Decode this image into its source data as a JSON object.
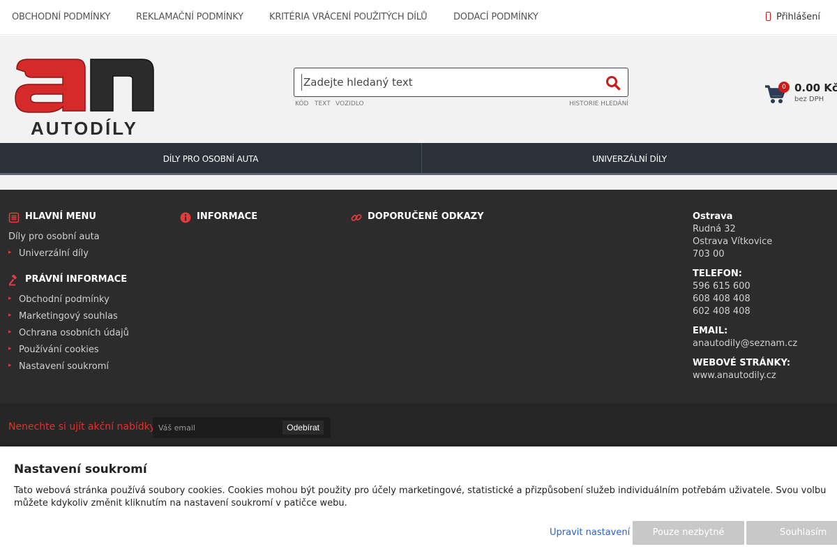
{
  "topbar": {
    "links": [
      "OBCHODNÍ PODMÍNKY",
      "REKLAMAČNÍ PODMÍNKY",
      "KRITÉRIA VRÁCENÍ POUŽITÝCH DÍLŮ",
      "DODACÍ PODMÍNKY"
    ],
    "login_label": "Přihlášení"
  },
  "logo": {
    "text": "AUTODÍLY",
    "colors": {
      "red": "#d42a2a",
      "dark": "#2b2b2b"
    }
  },
  "search": {
    "placeholder": "Zadejte hledaný text",
    "modes": [
      "KÓD",
      "TEXT",
      "VOZIDLO"
    ],
    "history_label": "HISTORIE HLEDÁNÍ"
  },
  "cart": {
    "count": "0",
    "price": "0.00 Kč",
    "vat_note": "bez DPH"
  },
  "nav": {
    "items": [
      "DÍLY PRO OSOBNÍ AUTA",
      "UNIVERZÁLNÍ DÍLY"
    ]
  },
  "footer": {
    "main_menu": {
      "title": "HLAVNÍ MENU",
      "items": [
        "Díly pro osobní auta",
        "Univerzální díly"
      ]
    },
    "legal": {
      "title": "PRÁVNÍ INFORMACE",
      "items": [
        "Obchodní podmínky",
        "Marketingový souhlas",
        "Ochrana osobních údajů",
        "Používání cookies",
        "Nastavení soukromí"
      ]
    },
    "info": {
      "title": "INFORMACE"
    },
    "links": {
      "title": "DOPORUČENÉ ODKAZY"
    },
    "contact": {
      "city": "Ostrava",
      "street": "Rudná 32",
      "district": "Ostrava Vítkovice",
      "zip": "703 00",
      "phone_label": "TELEFON:",
      "phones": [
        "596 615 600",
        "608 408 408",
        "602 408 408"
      ],
      "email_label": "EMAIL:",
      "email": "anautodily@seznam.cz",
      "web_label": "WEBOVÉ STRÁNKY:",
      "web": "www.anautodily.cz"
    }
  },
  "newsletter": {
    "label": "Nenechte si ujít akční nabídky",
    "placeholder": "Váš email",
    "button": "Odebírat"
  },
  "cookie": {
    "title": "Nastavení soukromí",
    "text": "Tato webová stránka používá soubory cookies. Cookies mohou být použity pro účely marketingové, statistické a přizpůsobení služeb individuálním potřebám uživatele. Svou volbu můžete kdykoliv změnit kliknutím na nastavení soukromí v patičce webu.",
    "settings_link": "Upravit nastavení",
    "necessary_button": "Pouze nezbytné",
    "accept_button": "Souhlasím"
  },
  "colors": {
    "accent": "#cc1a1a",
    "nav_bg": "#2b3138",
    "footer_bg": "#2c2c2c"
  }
}
